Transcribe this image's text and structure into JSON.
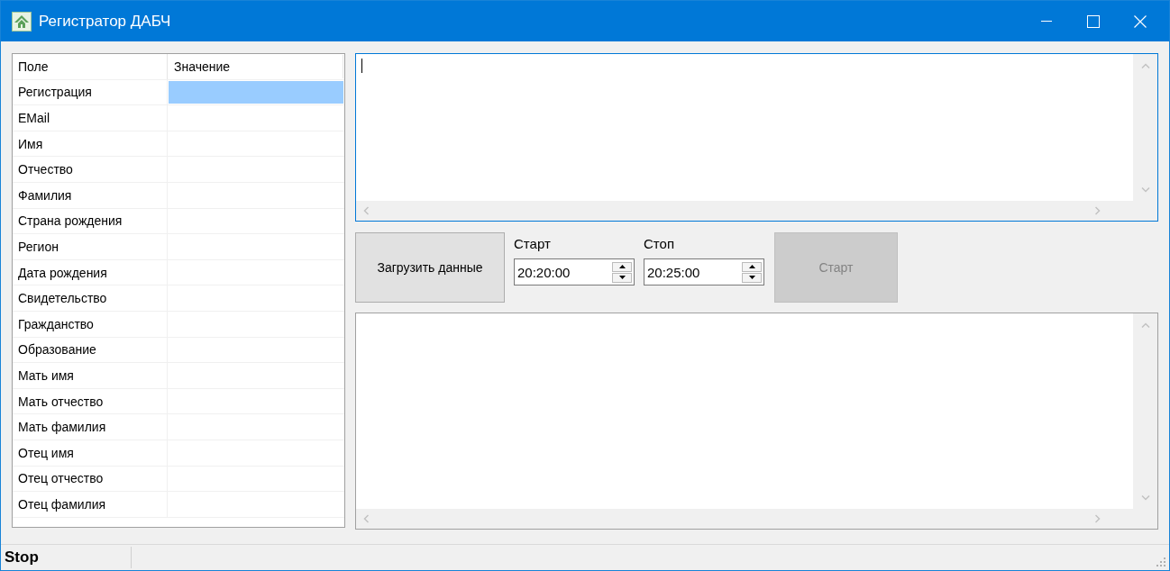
{
  "window": {
    "title": "Регистратор ДАБЧ"
  },
  "table": {
    "columns": [
      "Поле",
      "Значение"
    ],
    "rows": [
      {
        "field": "Регистрация",
        "value": "",
        "selected": true
      },
      {
        "field": "EMail",
        "selected": false
      },
      {
        "field": "Имя",
        "selected": false
      },
      {
        "field": "Отчество",
        "selected": false
      },
      {
        "field": "Фамилия",
        "selected": false
      },
      {
        "field": "Страна рождения",
        "selected": false
      },
      {
        "field": "Регион",
        "selected": false
      },
      {
        "field": "Дата рождения",
        "selected": false
      },
      {
        "field": "Свидетельство",
        "selected": false
      },
      {
        "field": "Гражданство",
        "selected": false
      },
      {
        "field": "Образование",
        "selected": false
      },
      {
        "field": "Мать имя",
        "selected": false
      },
      {
        "field": "Мать отчество",
        "selected": false
      },
      {
        "field": "Мать фамилия",
        "selected": false
      },
      {
        "field": "Отец имя",
        "selected": false
      },
      {
        "field": "Отец отчество",
        "selected": false
      },
      {
        "field": "Отец фамилия",
        "selected": false
      }
    ]
  },
  "text_areas": [
    {
      "focused": true
    },
    {
      "focused": false
    }
  ],
  "load_button": {
    "label": "Загрузить данные",
    "disabled": false
  },
  "time_fields": [
    {
      "label": "Старт",
      "value": "20:20:00"
    },
    {
      "label": "Стоп",
      "value": "20:25:00"
    }
  ],
  "start_button": {
    "label": "Старт",
    "disabled": true
  },
  "status_bar": {
    "text": "Stop"
  }
}
